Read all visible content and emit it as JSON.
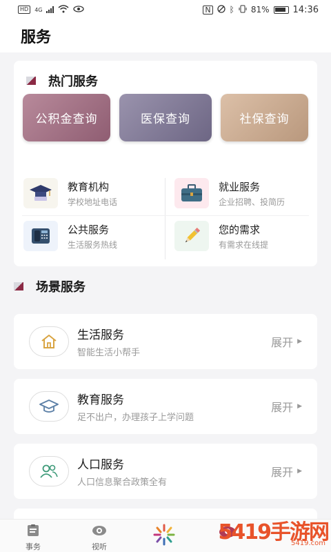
{
  "status_bar": {
    "time": "14:36",
    "battery": "81%",
    "network": "4G"
  },
  "app_bar": {
    "title": "服务"
  },
  "hot_services": {
    "title": "热门服务",
    "quick_buttons": [
      "公积金查询",
      "医保查询",
      "社保查询"
    ],
    "items": [
      {
        "icon": "graduation-cap-icon",
        "title": "教育机构",
        "subtitle": "学校地址电话"
      },
      {
        "icon": "briefcase-icon",
        "title": "就业服务",
        "subtitle": "企业招聘、投简历"
      },
      {
        "icon": "telephone-icon",
        "title": "公共服务",
        "subtitle": "生活服务热线"
      },
      {
        "icon": "pencil-icon",
        "title": "您的需求",
        "subtitle": "有需求在线提"
      }
    ]
  },
  "scene_services": {
    "title": "场景服务",
    "items": [
      {
        "icon": "house-icon",
        "title": "生活服务",
        "subtitle": "智能生活小帮手",
        "action": "展开"
      },
      {
        "icon": "mortarboard-icon",
        "title": "教育服务",
        "subtitle": "足不出户，办理孩子上学问题",
        "action": "展开"
      },
      {
        "icon": "people-icon",
        "title": "人口服务",
        "subtitle": "人口信息聚合政策全有",
        "action": "展开"
      }
    ]
  },
  "tab_bar": {
    "tabs": [
      {
        "label": "事务",
        "icon": "clipboard-icon"
      },
      {
        "label": "视听",
        "icon": "eye-icon"
      },
      {
        "label": "",
        "icon": "logo-icon"
      },
      {
        "label": "",
        "icon": "service-icon"
      }
    ]
  },
  "watermark": {
    "text": "5419手游网",
    "sub": "5419.com"
  },
  "colors": {
    "accent": "#8b2a45",
    "btn_1": "#a77588",
    "btn_2": "#857e9a",
    "btn_3": "#ccaf95"
  }
}
